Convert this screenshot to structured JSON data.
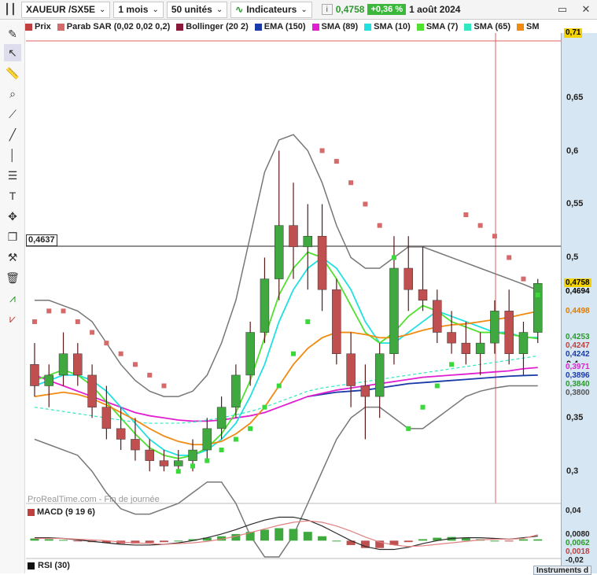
{
  "toolbar": {
    "symbol": "XAUEUR /SX5E",
    "period": "1 mois",
    "units": "50 unités",
    "indicators_label": "Indicateurs",
    "last_price": "0,4758",
    "change": "+0,36 %",
    "date": "1 août 2024"
  },
  "legend": [
    {
      "label": "Prix",
      "color": "#c04040"
    },
    {
      "label": "Parab SAR (0,02 0,02 0,2)",
      "color": "#d46a6a"
    },
    {
      "label": "Bollinger (20 2)",
      "color": "#8a1a3a"
    },
    {
      "label": "EMA (150)",
      "color": "#1a3aa8"
    },
    {
      "label": "SMA (89)",
      "color": "#e020d0"
    },
    {
      "label": "SMA (10)",
      "color": "#20e0e0"
    },
    {
      "label": "SMA (7)",
      "color": "#50e030"
    },
    {
      "label": "SMA (65)",
      "color": "#30e8c0"
    },
    {
      "label": "SM",
      "color": "#f08a10"
    }
  ],
  "cursor_value": "0,4637",
  "watermark": "ProRealTime.com - Fin de journée",
  "macd_label": "MACD (9 19 6)",
  "rsi_label": "RSI (30)",
  "instruments_tab": "Instruments d",
  "y_axis_ticks": [
    "0,65",
    "0,6",
    "0,55",
    "0,5",
    "0,45",
    "0,4",
    "0,35",
    "0,3"
  ],
  "price_badges": [
    {
      "text": "0,71",
      "bg": "#f2d200",
      "fg": "#000"
    },
    {
      "text": "0,4758",
      "bg": "#f2d200",
      "fg": "#000"
    },
    {
      "text": "0,4694",
      "bg": "#d6e6f2",
      "fg": "#000"
    },
    {
      "text": "0,4498",
      "bg": "#d6e6f2",
      "fg": "#e07a00"
    },
    {
      "text": "0,4253",
      "bg": "#d6e6f2",
      "fg": "#2a9a2a"
    },
    {
      "text": "0,4247",
      "bg": "#d6e6f2",
      "fg": "#c04040"
    },
    {
      "text": "0,4242",
      "bg": "#d6e6f2",
      "fg": "#1a3aa8"
    },
    {
      "text": "0,3971",
      "bg": "#d6e6f2",
      "fg": "#e020d0"
    },
    {
      "text": "0,3896",
      "bg": "#d6e6f2",
      "fg": "#1a3aa8"
    },
    {
      "text": "0,3840",
      "bg": "#d6e6f2",
      "fg": "#2a9a2a"
    },
    {
      "text": "0,3800",
      "bg": "#d6e6f2",
      "fg": "#555"
    }
  ],
  "macd_ticks": [
    "0,04",
    "0,0080",
    "0,0062",
    "0,0018",
    "-0,02"
  ],
  "chart_data": {
    "type": "candlestick",
    "ylim": [
      0.27,
      0.71
    ],
    "candles": [
      [
        0.4,
        0.42,
        0.37,
        0.38
      ],
      [
        0.38,
        0.4,
        0.36,
        0.39
      ],
      [
        0.39,
        0.43,
        0.38,
        0.41
      ],
      [
        0.41,
        0.42,
        0.38,
        0.39
      ],
      [
        0.39,
        0.4,
        0.35,
        0.36
      ],
      [
        0.36,
        0.38,
        0.33,
        0.34
      ],
      [
        0.34,
        0.36,
        0.32,
        0.33
      ],
      [
        0.33,
        0.35,
        0.31,
        0.32
      ],
      [
        0.32,
        0.33,
        0.3,
        0.31
      ],
      [
        0.31,
        0.32,
        0.3,
        0.305
      ],
      [
        0.305,
        0.32,
        0.3,
        0.31
      ],
      [
        0.31,
        0.33,
        0.3,
        0.32
      ],
      [
        0.32,
        0.35,
        0.31,
        0.34
      ],
      [
        0.34,
        0.37,
        0.33,
        0.36
      ],
      [
        0.36,
        0.4,
        0.35,
        0.39
      ],
      [
        0.39,
        0.44,
        0.38,
        0.43
      ],
      [
        0.43,
        0.5,
        0.42,
        0.48
      ],
      [
        0.48,
        0.6,
        0.46,
        0.53
      ],
      [
        0.53,
        0.57,
        0.48,
        0.51
      ],
      [
        0.51,
        0.55,
        0.47,
        0.52
      ],
      [
        0.52,
        0.55,
        0.45,
        0.47
      ],
      [
        0.47,
        0.48,
        0.4,
        0.41
      ],
      [
        0.41,
        0.43,
        0.36,
        0.38
      ],
      [
        0.38,
        0.4,
        0.33,
        0.37
      ],
      [
        0.37,
        0.42,
        0.35,
        0.41
      ],
      [
        0.41,
        0.52,
        0.4,
        0.49
      ],
      [
        0.49,
        0.52,
        0.45,
        0.47
      ],
      [
        0.47,
        0.51,
        0.45,
        0.46
      ],
      [
        0.46,
        0.47,
        0.42,
        0.43
      ],
      [
        0.43,
        0.45,
        0.41,
        0.42
      ],
      [
        0.42,
        0.44,
        0.4,
        0.41
      ],
      [
        0.41,
        0.43,
        0.39,
        0.42
      ],
      [
        0.42,
        0.46,
        0.41,
        0.45
      ],
      [
        0.45,
        0.47,
        0.4,
        0.41
      ],
      [
        0.41,
        0.44,
        0.39,
        0.43
      ],
      [
        0.43,
        0.48,
        0.42,
        0.4758
      ]
    ],
    "series": [
      {
        "name": "EMA (150)",
        "values": [
          null,
          null,
          null,
          null,
          null,
          null,
          null,
          null,
          null,
          null,
          null,
          null,
          null,
          null,
          null,
          null,
          null,
          null,
          null,
          0.37,
          0.372,
          0.374,
          0.375,
          0.376,
          0.378,
          0.38,
          0.382,
          0.383,
          0.384,
          0.385,
          0.386,
          0.387,
          0.388,
          0.389,
          0.3896,
          0.39
        ]
      },
      {
        "name": "SMA (89)",
        "values": [
          0.39,
          0.385,
          0.38,
          0.375,
          0.37,
          0.365,
          0.36,
          0.355,
          0.352,
          0.35,
          0.348,
          0.347,
          0.347,
          0.348,
          0.35,
          0.352,
          0.355,
          0.36,
          0.365,
          0.37,
          0.373,
          0.376,
          0.378,
          0.38,
          0.382,
          0.384,
          0.386,
          0.388,
          0.389,
          0.39,
          0.391,
          0.392,
          0.393,
          0.394,
          0.396,
          0.3971
        ]
      },
      {
        "name": "SMA (10)",
        "values": [
          0.38,
          0.385,
          0.39,
          0.39,
          0.385,
          0.375,
          0.36,
          0.345,
          0.33,
          0.32,
          0.315,
          0.315,
          0.32,
          0.33,
          0.345,
          0.37,
          0.4,
          0.44,
          0.47,
          0.49,
          0.5,
          0.49,
          0.47,
          0.44,
          0.42,
          0.42,
          0.43,
          0.44,
          0.45,
          0.445,
          0.44,
          0.435,
          0.43,
          0.43,
          0.425,
          0.4253
        ]
      },
      {
        "name": "SMA (7)",
        "values": [
          0.385,
          0.39,
          0.395,
          0.39,
          0.38,
          0.365,
          0.35,
          0.335,
          0.322,
          0.315,
          0.312,
          0.315,
          0.322,
          0.335,
          0.355,
          0.385,
          0.425,
          0.465,
          0.49,
          0.505,
          0.5,
          0.48,
          0.455,
          0.43,
          0.42,
          0.43,
          0.445,
          0.455,
          0.45,
          0.44,
          0.435,
          0.43,
          0.43,
          0.428,
          0.426,
          0.4242
        ]
      },
      {
        "name": "SMA (65)",
        "values": [
          0.36,
          0.358,
          0.356,
          0.354,
          0.352,
          0.35,
          0.348,
          0.346,
          0.345,
          0.345,
          0.345,
          0.346,
          0.348,
          0.35,
          0.353,
          0.356,
          0.36,
          0.365,
          0.37,
          0.375,
          0.378,
          0.38,
          0.382,
          0.384,
          0.386,
          0.388,
          0.39,
          0.392,
          0.394,
          0.396,
          0.398,
          0.4,
          0.402,
          0.404,
          0.406,
          0.408
        ]
      },
      {
        "name": "SM",
        "values": [
          0.37,
          0.372,
          0.374,
          0.372,
          0.368,
          0.362,
          0.355,
          0.348,
          0.34,
          0.333,
          0.328,
          0.325,
          0.325,
          0.328,
          0.335,
          0.345,
          0.36,
          0.38,
          0.4,
          0.415,
          0.425,
          0.43,
          0.43,
          0.428,
          0.425,
          0.425,
          0.428,
          0.432,
          0.435,
          0.437,
          0.438,
          0.44,
          0.442,
          0.444,
          0.447,
          0.4498
        ]
      }
    ],
    "bollinger": {
      "upper": [
        0.46,
        0.46,
        0.455,
        0.45,
        0.44,
        0.42,
        0.4,
        0.385,
        0.375,
        0.37,
        0.37,
        0.375,
        0.39,
        0.42,
        0.46,
        0.52,
        0.58,
        0.61,
        0.615,
        0.6,
        0.57,
        0.53,
        0.5,
        0.49,
        0.49,
        0.5,
        0.51,
        0.51,
        0.505,
        0.5,
        0.495,
        0.49,
        0.485,
        0.48,
        0.475,
        0.4694
      ],
      "lower": [
        0.33,
        0.325,
        0.32,
        0.315,
        0.3,
        0.28,
        0.265,
        0.26,
        0.26,
        0.265,
        0.27,
        0.28,
        0.29,
        0.29,
        0.27,
        0.24,
        0.22,
        0.22,
        0.24,
        0.27,
        0.3,
        0.33,
        0.35,
        0.36,
        0.36,
        0.35,
        0.34,
        0.34,
        0.35,
        0.36,
        0.37,
        0.375,
        0.378,
        0.38,
        0.38,
        0.38
      ]
    },
    "sar": [
      0.44,
      0.45,
      0.45,
      0.44,
      0.43,
      0.42,
      0.41,
      0.4,
      0.39,
      0.38,
      0.3,
      0.305,
      0.31,
      0.32,
      0.33,
      0.34,
      0.36,
      0.38,
      0.41,
      0.44,
      0.6,
      0.59,
      0.57,
      0.55,
      0.53,
      0.5,
      0.34,
      0.36,
      0.38,
      0.4,
      0.54,
      0.53,
      0.52,
      0.5,
      0.48,
      0.465
    ],
    "macd": {
      "hist": [
        0.003,
        0.002,
        0.001,
        -0.001,
        -0.002,
        -0.003,
        -0.004,
        -0.004,
        -0.003,
        -0.002,
        0.0,
        0.002,
        0.004,
        0.006,
        0.009,
        0.012,
        0.015,
        0.017,
        0.016,
        0.012,
        0.006,
        0.0,
        -0.006,
        -0.01,
        -0.01,
        -0.006,
        -0.002,
        0.002,
        0.004,
        0.005,
        0.004,
        0.002,
        0.0,
        -0.001,
        0.0018,
        0.0018
      ],
      "line": [
        0.004,
        0.004,
        0.003,
        0.001,
        -0.001,
        -0.003,
        -0.005,
        -0.006,
        -0.006,
        -0.005,
        -0.003,
        0.0,
        0.004,
        0.009,
        0.015,
        0.022,
        0.028,
        0.032,
        0.032,
        0.028,
        0.02,
        0.01,
        0.0,
        -0.008,
        -0.012,
        -0.012,
        -0.009,
        -0.004,
        0.0,
        0.003,
        0.004,
        0.004,
        0.003,
        0.002,
        0.004,
        0.0062
      ],
      "signal": [
        0.003,
        0.003,
        0.003,
        0.002,
        0.001,
        0.0,
        -0.002,
        -0.003,
        -0.004,
        -0.005,
        -0.004,
        -0.003,
        -0.001,
        0.002,
        0.006,
        0.011,
        0.016,
        0.021,
        0.025,
        0.027,
        0.025,
        0.02,
        0.013,
        0.005,
        -0.002,
        -0.006,
        -0.008,
        -0.007,
        -0.005,
        -0.003,
        -0.001,
        0.001,
        0.002,
        0.002,
        0.003,
        0.008
      ]
    }
  }
}
